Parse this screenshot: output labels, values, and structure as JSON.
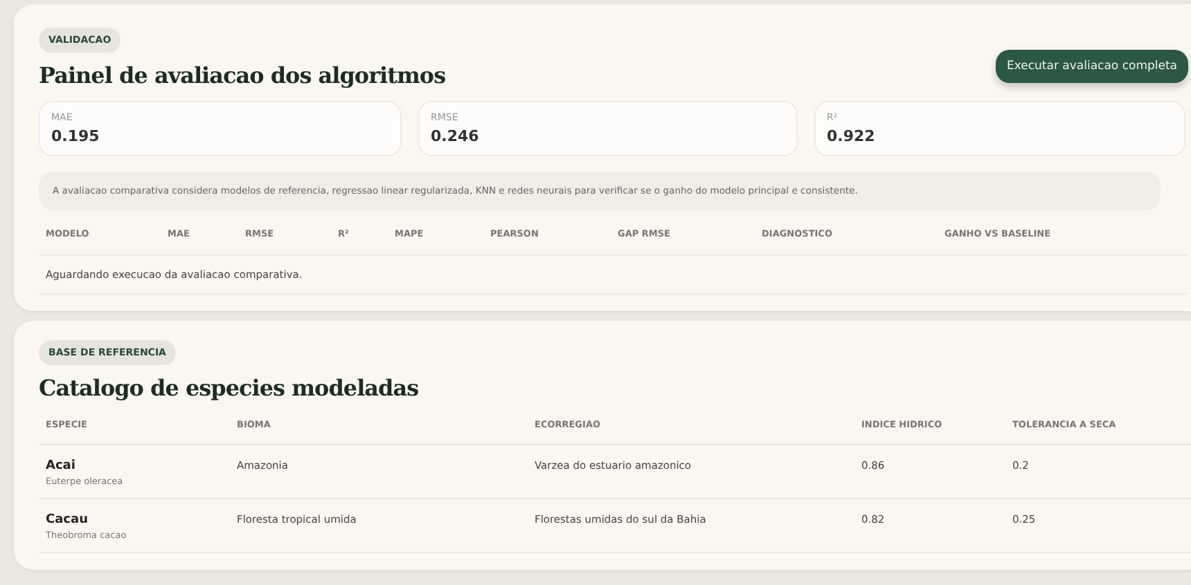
{
  "validation": {
    "badge": "VALIDACAO",
    "title": "Painel de avaliacao dos algoritmos",
    "action": "Executar avaliacao completa",
    "metrics": [
      {
        "label": "MAE",
        "value": "0.195"
      },
      {
        "label": "RMSE",
        "value": "0.246"
      },
      {
        "label": "R²",
        "value": "0.922"
      }
    ],
    "note": "A avaliacao comparativa considera modelos de referencia, regressao linear regularizada, KNN e redes neurais para verificar se o ganho do modelo principal e consistente.",
    "table": {
      "columns": [
        "MODELO",
        "MAE",
        "RMSE",
        "R²",
        "MAPE",
        "PEARSON",
        "GAP RMSE",
        "DIAGNOSTICO",
        "GANHO VS BASELINE"
      ],
      "empty_message": "Aguardando execucao da avaliacao comparativa."
    }
  },
  "catalog": {
    "badge": "BASE DE REFERENCIA",
    "title": "Catalogo de especies modeladas",
    "columns": [
      "ESPECIE",
      "BIOMA",
      "ECORREGIAO",
      "INDICE HIDRICO",
      "TOLERANCIA A SECA"
    ],
    "rows": [
      {
        "name": "Acai",
        "scientific_name": "Euterpe oleracea",
        "biome": "Amazonia",
        "ecoregion": "Varzea do estuario amazonico",
        "water_index": "0.86",
        "drought_tolerance": "0.2"
      },
      {
        "name": "Cacau",
        "scientific_name": "Theobroma cacao",
        "biome": "Floresta tropical umida",
        "ecoregion": "Florestas umidas do sul da Bahia",
        "water_index": "0.82",
        "drought_tolerance": "0.25"
      }
    ]
  }
}
